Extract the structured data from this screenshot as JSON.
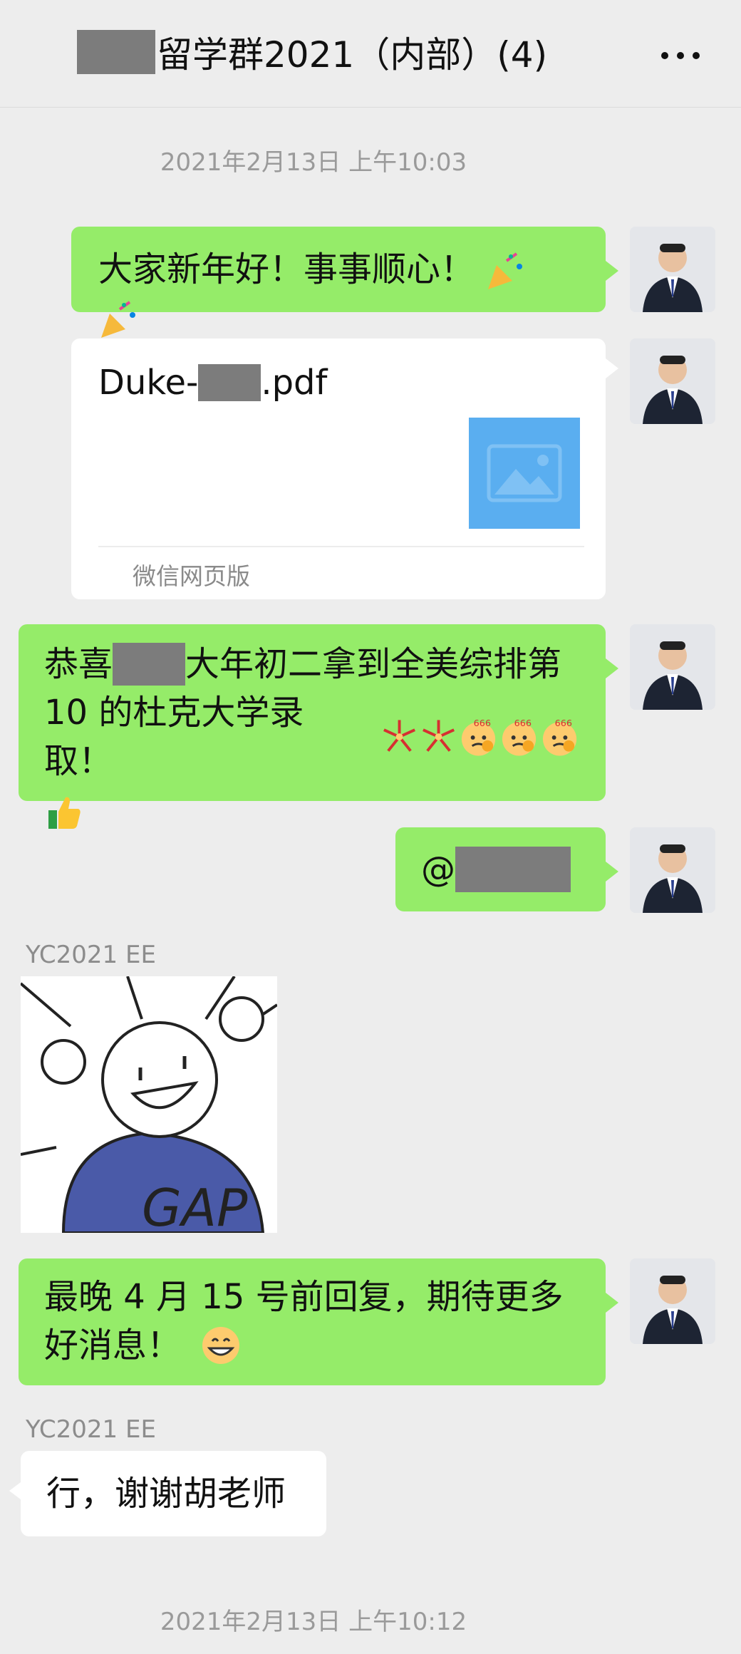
{
  "header": {
    "title": "留学群2021（内部）(4)",
    "more_icon": "more-icon",
    "more_label": "···"
  },
  "timestamps": [
    "2021年2月13日 上午10:03",
    "2021年2月13日 上午10:12"
  ],
  "messages": [
    {
      "type": "text",
      "from": "self",
      "text": "大家新年好！事事顺心！",
      "emojis": [
        "party-popper-icon",
        "party-popper-icon"
      ]
    },
    {
      "type": "file",
      "from": "self",
      "filename_prefix": "Duke-",
      "filename_suffix": ".pdf",
      "source": "微信网页版",
      "thumb_icon": "image-placeholder-icon"
    },
    {
      "type": "text",
      "from": "self",
      "line1": "恭喜",
      "line1_rest": "大年初二拿到全美综排第",
      "line2": "10 的杜克大学录取！",
      "emojis": [
        "firework-icon",
        "firework-icon",
        "666-emoji-icon",
        "666-emoji-icon",
        "666-emoji-icon",
        "thumbs-up-icon"
      ]
    },
    {
      "type": "mention",
      "from": "self",
      "text": "@"
    },
    {
      "type": "sticker",
      "from": "YC2021 EE",
      "sender": "YC2021 EE",
      "sticker_text": "GAP"
    },
    {
      "type": "text",
      "from": "self",
      "line1": "最晚 4 月 15 号前回复，期待更多",
      "line2": "好消息！",
      "emojis": [
        "grinning-face-icon"
      ]
    },
    {
      "type": "text",
      "from": "YC2021 EE",
      "sender": "YC2021 EE",
      "text": "行，谢谢胡老师"
    }
  ],
  "colors": {
    "green_bubble": "#95ec69",
    "background": "#ededed",
    "redaction": "#7c7c7c"
  }
}
